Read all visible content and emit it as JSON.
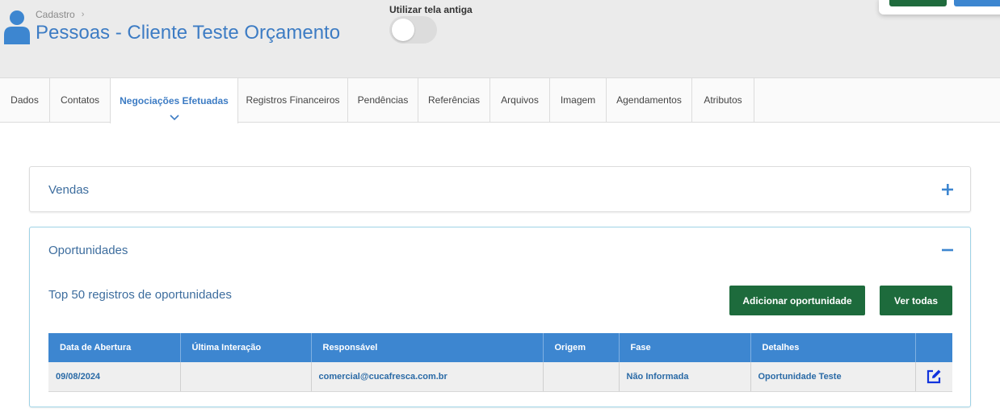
{
  "header": {
    "breadcrumb": "Cadastro",
    "title": "Pessoas - Cliente Teste Orçamento",
    "toggle_label": "Utilizar tela antiga",
    "toggle_on": false
  },
  "tabs": [
    {
      "label": "Dados"
    },
    {
      "label": "Contatos"
    },
    {
      "label": "Negociações Efetuadas",
      "active": true
    },
    {
      "label": "Registros Financeiros"
    },
    {
      "label": "Pendências"
    },
    {
      "label": "Referências"
    },
    {
      "label": "Arquivos"
    },
    {
      "label": "Imagem"
    },
    {
      "label": "Agendamentos"
    },
    {
      "label": "Atributos"
    }
  ],
  "panels": {
    "vendas": {
      "title": "Vendas",
      "toggle_icon": "plus-icon"
    },
    "oportunidades": {
      "title": "Oportunidades",
      "toggle_icon": "minus-icon",
      "subtitle": "Top 50 registros de oportunidades",
      "add_button": "Adicionar oportunidade",
      "view_all_button": "Ver todas",
      "columns": [
        "Data de Abertura",
        "Última Interação",
        "Responsável",
        "Origem",
        "Fase",
        "Detalhes",
        ""
      ],
      "rows": [
        {
          "data_abertura": "09/08/2024",
          "ultima_interacao": "",
          "responsavel": "comercial@cucafresca.com.br",
          "origem": "",
          "fase": "Não Informada",
          "detalhes": "Oportunidade Teste",
          "action_icon": "edit-icon"
        }
      ]
    }
  },
  "colors": {
    "accent": "#3d7cc4",
    "primary_button": "#1d6b3c",
    "table_header": "#3d86d0",
    "header_bg": "#ebebeb"
  }
}
